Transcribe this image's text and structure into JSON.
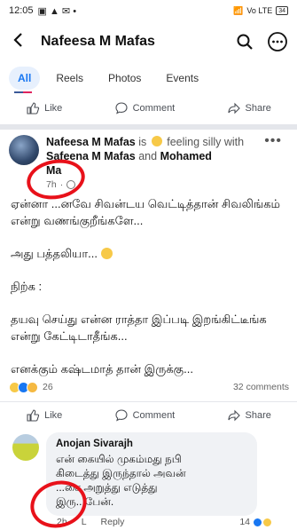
{
  "status_bar": {
    "time": "12:05",
    "signal": "Vo LTE",
    "battery": "34"
  },
  "header": {
    "title": "Nafeesa M Mafas"
  },
  "tabs": [
    "All",
    "Reels",
    "Photos",
    "Events"
  ],
  "actions": {
    "like": "Like",
    "comment": "Comment",
    "share": "Share"
  },
  "post": {
    "author": "Nafeesa M Mafas",
    "is_text": "is",
    "feeling": "feeling silly",
    "with_text": "with",
    "tagged_1": "Safeena M Mafas",
    "and_text": "and",
    "tagged_2": "Mohamed",
    "tagged_2_cont": "Ma",
    "time": "7h",
    "body": [
      "ஏன்னா ...னவே சிவன்டய வெட்டித்தான் சிவலிங்கம் என்று வணங்குறீங்களே...",
      "அது பத்தலியா...",
      "நிற்க :",
      "தயவு செய்து என்ன ராத்தா இப்படி இறங்கிட்டீங்க என்று கேட்டிடாதீங்க...",
      "எனக்கும் கஷ்டமாத் தான் இருக்கு..."
    ],
    "reaction_count": "26",
    "comment_count": "32 comments"
  },
  "comment": {
    "author": "Anojan Sivarajh",
    "line1": "என் கையில் முகம்மது நபி",
    "line2": "கிடைத்து இருந்தால் அவன்",
    "line3": "...சை அறுத்து எடுத்து",
    "line4": "இரு...பேன்.",
    "time": "2h",
    "like": "L",
    "reply": "Reply",
    "like_count": "14"
  },
  "colors": {
    "accent": "#1877f2",
    "annotation_ring": "#e8111a"
  }
}
